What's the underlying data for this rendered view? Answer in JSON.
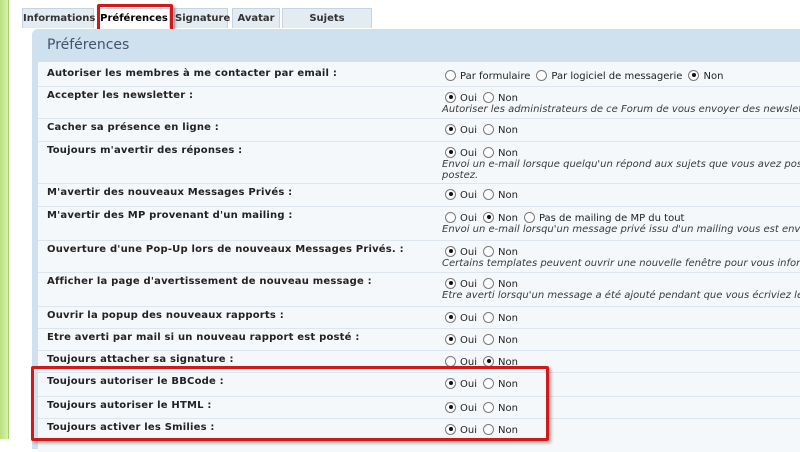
{
  "tabs": [
    "Informations",
    "Préférences",
    "Signature",
    "Avatar",
    "Sujets surveillés"
  ],
  "panel_title": "Préférences",
  "rows": [
    {
      "label": "Autoriser les membres à me contacter par email :",
      "options": [
        {
          "label": "Par formulaire",
          "checked": false
        },
        {
          "label": "Par logiciel de messagerie",
          "checked": false
        },
        {
          "label": "Non",
          "checked": true
        }
      ]
    },
    {
      "label": "Accepter les newsletter :",
      "options": [
        {
          "label": "Oui",
          "checked": true
        },
        {
          "label": "Non",
          "checked": false
        }
      ],
      "explain": "Autoriser les administrateurs de ce Forum de vous envoyer des newsletters p"
    },
    {
      "label": "Cacher sa présence en ligne :",
      "options": [
        {
          "label": "Oui",
          "checked": true
        },
        {
          "label": "Non",
          "checked": false
        }
      ]
    },
    {
      "label": "Toujours m'avertir des réponses :",
      "options": [
        {
          "label": "Oui",
          "checked": true
        },
        {
          "label": "Non",
          "checked": false
        }
      ],
      "explain": "Envoi un e-mail lorsque quelqu'un répond aux sujets que vous avez posté. Ce",
      "explain2": "postez."
    },
    {
      "label": "M'avertir des nouveaux Messages Privés :",
      "options": [
        {
          "label": "Oui",
          "checked": true
        },
        {
          "label": "Non",
          "checked": false
        }
      ]
    },
    {
      "label": "M'avertir des MP provenant d'un mailing :",
      "options": [
        {
          "label": "Oui",
          "checked": false
        },
        {
          "label": "Non",
          "checked": true
        },
        {
          "label": "Pas de mailing de MP du tout",
          "checked": false
        }
      ],
      "explain": "Envoi un e-mail lorsqu'un message privé issu d'un mailing vous est envoyé p"
    },
    {
      "label": "Ouverture d'une Pop-Up lors de nouveaux Messages Privés. :",
      "options": [
        {
          "label": "Oui",
          "checked": true
        },
        {
          "label": "Non",
          "checked": false
        }
      ],
      "explain": "Certains templates peuvent ouvrir une nouvelle fenêtre pour vous informer d"
    },
    {
      "label": "Afficher la page d'avertissement de nouveau message :",
      "options": [
        {
          "label": "Oui",
          "checked": true
        },
        {
          "label": "Non",
          "checked": false
        }
      ],
      "explain": "Etre averti lorsqu'un message a été ajouté pendant que vous écriviez le votre"
    },
    {
      "label": "Ouvrir la popup des nouveaux rapports :",
      "options": [
        {
          "label": "Oui",
          "checked": true
        },
        {
          "label": "Non",
          "checked": false
        }
      ]
    },
    {
      "label": "Etre averti par mail si un nouveau rapport est posté :",
      "options": [
        {
          "label": "Oui",
          "checked": true
        },
        {
          "label": "Non",
          "checked": false
        }
      ]
    },
    {
      "label": "Toujours attacher sa signature :",
      "options": [
        {
          "label": "Oui",
          "checked": false
        },
        {
          "label": "Non",
          "checked": true
        }
      ]
    },
    {
      "label": "Toujours autoriser le BBCode :",
      "options": [
        {
          "label": "Oui",
          "checked": true
        },
        {
          "label": "Non",
          "checked": false
        }
      ]
    },
    {
      "label": "Toujours autoriser le HTML :",
      "options": [
        {
          "label": "Oui",
          "checked": true
        },
        {
          "label": "Non",
          "checked": false
        }
      ]
    },
    {
      "label": "Toujours activer les Smilies :",
      "options": [
        {
          "label": "Oui",
          "checked": true
        },
        {
          "label": "Non",
          "checked": false
        }
      ]
    }
  ]
}
